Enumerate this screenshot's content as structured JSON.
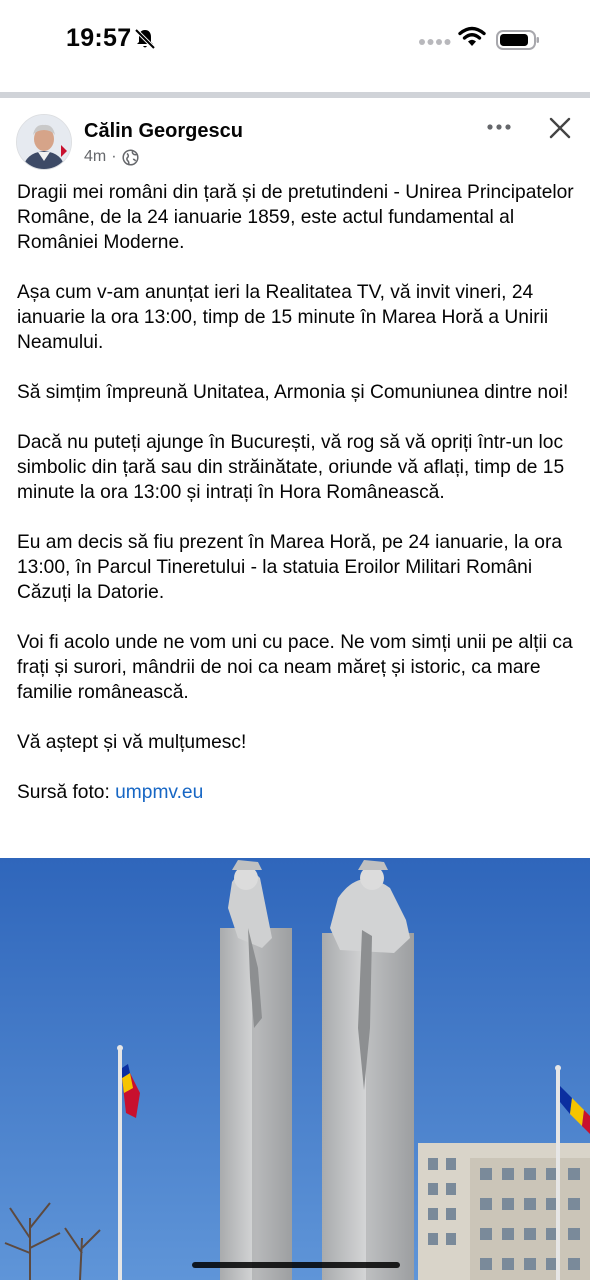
{
  "status_bar": {
    "time": "19:57",
    "icons": [
      "bell-slash-icon",
      "signal-dots-icon",
      "wifi-icon",
      "battery-icon"
    ]
  },
  "post": {
    "author": "Călin Georgescu",
    "time_ago": "4m",
    "separator": "·",
    "audience_icon": "globe-icon",
    "paragraphs": [
      "Dragii mei români din țară și de pretutindeni - Unirea Principatelor Române, de la 24 ianuarie 1859, este actul fundamental al României Moderne.",
      "Așa cum v-am anunțat ieri la Realitatea TV, vă invit vineri, 24 ianuarie la ora 13:00, timp de 15 minute în Marea Horă a Unirii Neamului.",
      "Să simțim împreună Unitatea, Armonia și Comuniunea dintre noi!",
      "Dacă nu puteți ajunge în București, vă rog să vă opriți într-un loc simbolic din țară sau din străinătate, oriunde vă aflați, timp de 15 minute la ora 13:00 și intrați în Hora Românească.",
      "Eu am decis să fiu prezent în Marea Horă, pe 24 ianuarie, la ora 13:00, în Parcul Tineretului - la statuia Eroilor Militari Români Căzuți la Datorie.",
      "Voi fi acolo unde ne vom uni cu pace. Ne vom simți unii pe alții ca frați și surori, mândrii de noi ca neam măreț și istoric, ca mare familie românească.",
      "Vă aștept și vă mulțumesc!"
    ],
    "source_label": "Sursă foto: ",
    "source_link": "umpmv.eu"
  },
  "colors": {
    "link": "#1666c4",
    "sky": "#3a73c4",
    "flag_blue": "#0b2fa0",
    "flag_yellow": "#f5c400",
    "flag_red": "#c8102e"
  }
}
